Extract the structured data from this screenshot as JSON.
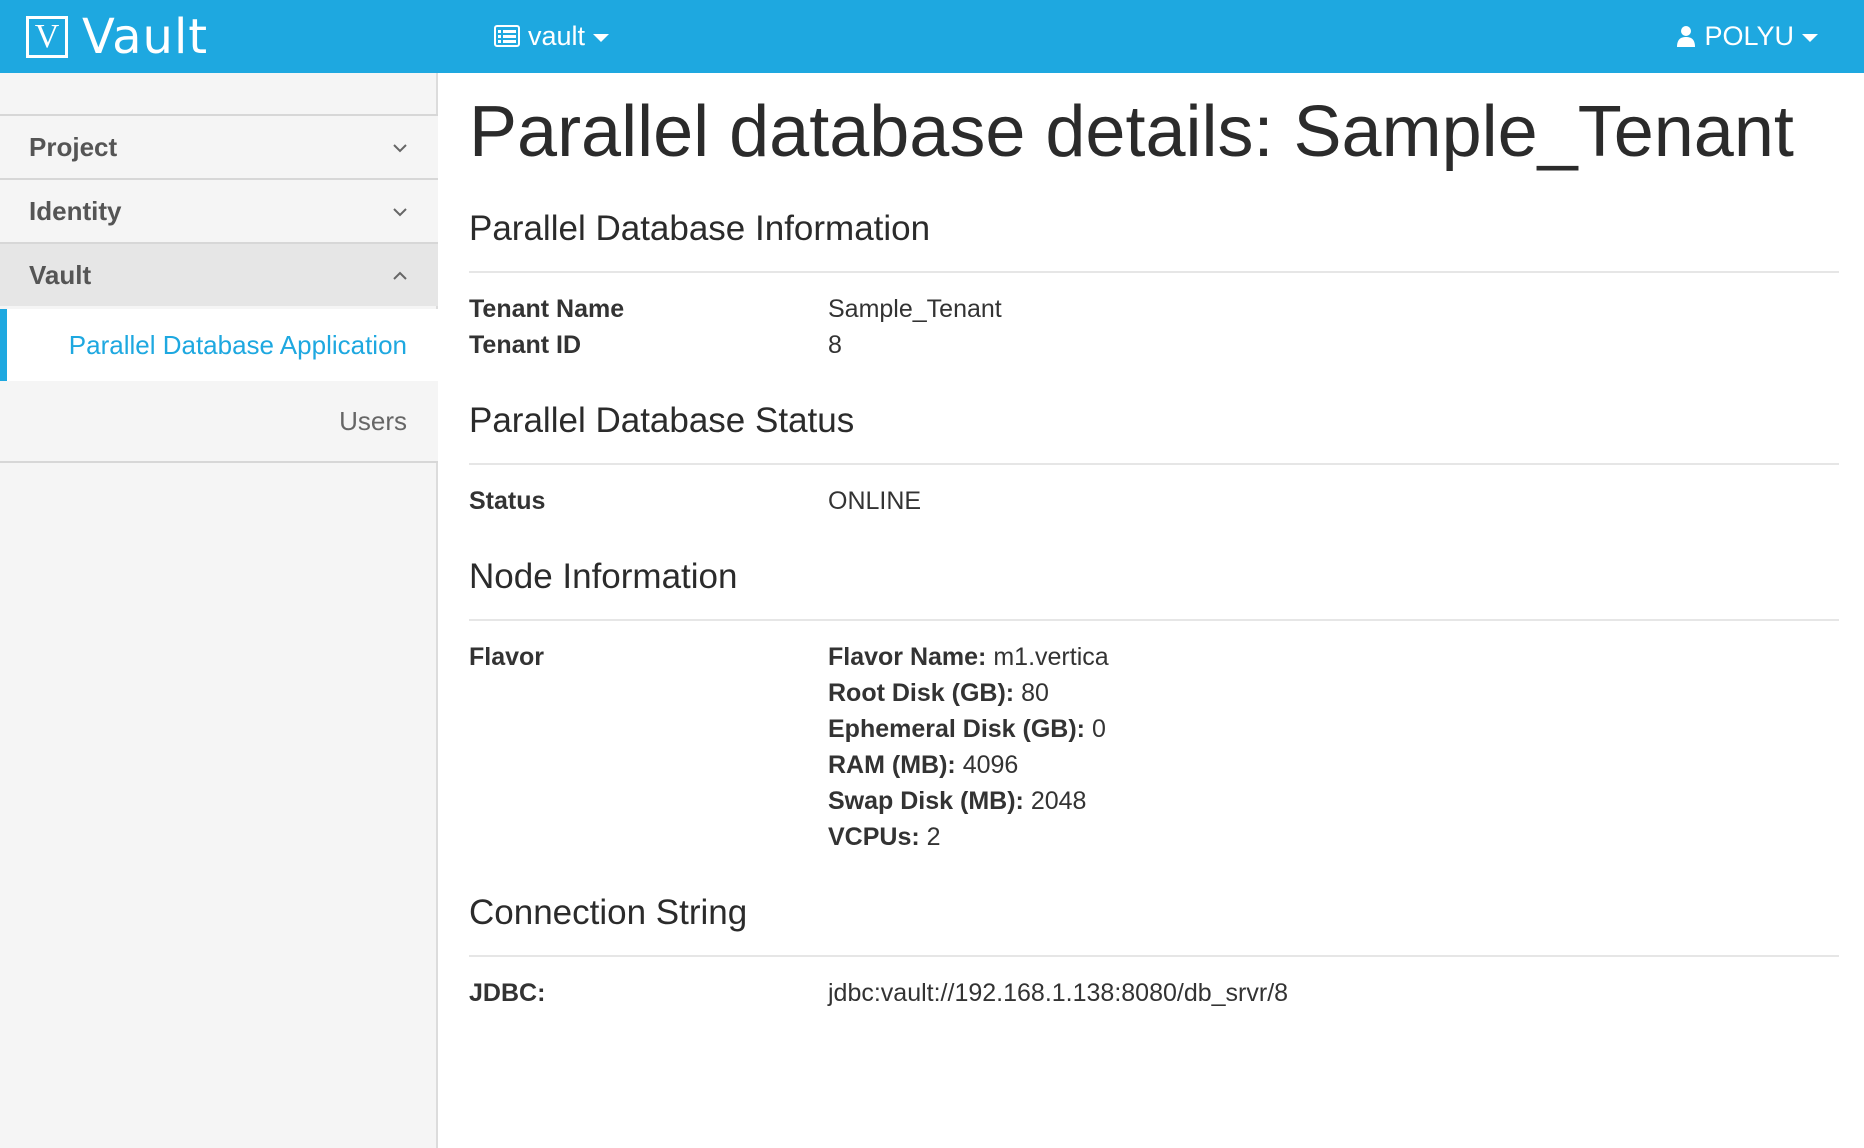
{
  "navbar": {
    "brand_logo_letter": "V",
    "brand_name": "Vault",
    "project_switcher": "vault",
    "user_menu": "POLYU"
  },
  "sidebar": {
    "groups": [
      {
        "label": "Project"
      },
      {
        "label": "Identity"
      },
      {
        "label": "Vault"
      }
    ],
    "items": [
      {
        "label": "Parallel Database Application"
      },
      {
        "label": "Users"
      }
    ]
  },
  "page": {
    "title": "Parallel database details: Sample_Tenant"
  },
  "info": {
    "heading": "Parallel Database Information",
    "tenant_name_label": "Tenant Name",
    "tenant_name_value": "Sample_Tenant",
    "tenant_id_label": "Tenant ID",
    "tenant_id_value": "8"
  },
  "status": {
    "heading": "Parallel Database Status",
    "status_label": "Status",
    "status_value": "ONLINE"
  },
  "node": {
    "heading": "Node Information",
    "flavor_label": "Flavor",
    "flavor_details": [
      {
        "key": "Flavor Name:",
        "value": "m1.vertica"
      },
      {
        "key": "Root Disk (GB):",
        "value": "80"
      },
      {
        "key": "Ephemeral Disk (GB):",
        "value": "0"
      },
      {
        "key": "RAM (MB):",
        "value": "4096"
      },
      {
        "key": "Swap Disk (MB):",
        "value": "2048"
      },
      {
        "key": "VCPUs:",
        "value": "2"
      }
    ]
  },
  "connection": {
    "heading": "Connection String",
    "jdbc_label": "JDBC:",
    "jdbc_value": "jdbc:vault://192.168.1.138:8080/db_srvr/8"
  },
  "colors": {
    "accent": "#1ea8e0",
    "sidebar_bg": "#f5f5f5",
    "sidebar_active": "#e6e6e6"
  },
  "icons": {
    "project_switcher": "list-icon",
    "user_menu": "user-icon",
    "group_collapsed": "chevron-down-icon",
    "group_expanded": "chevron-up-icon"
  }
}
